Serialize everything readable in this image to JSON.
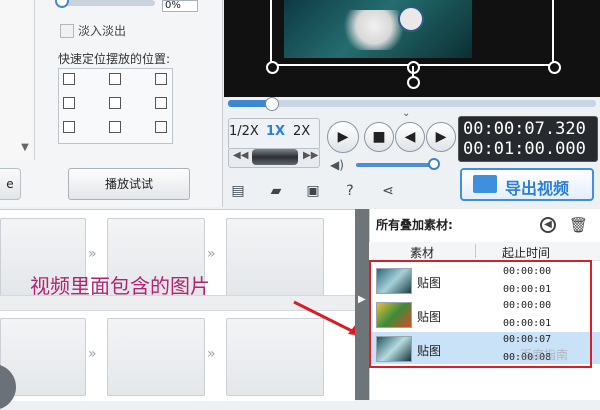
{
  "left_panel": {
    "percent_value": "0%",
    "fade_label": "淡入淡出",
    "quick_position_label": "快速定位摆放的位置:",
    "play_test_button": "播放试试"
  },
  "player": {
    "speed_options": [
      "1/2X",
      "1X",
      "2X"
    ],
    "selected_speed": "1X",
    "current_time": "00:00:07.320",
    "total_time": "00:01:00.000",
    "seek_progress": 0.12,
    "volume_level": 0.9
  },
  "toolbar": {
    "icons": [
      "new-icon",
      "open-folder-icon",
      "save-icon",
      "help-icon",
      "share-icon"
    ],
    "export_label": "导出视频"
  },
  "storyboard": {
    "annotation": "视频里面包含的图片"
  },
  "overlay_panel": {
    "title": "所有叠加素材:",
    "col_material": "素材",
    "col_time": "起止时间",
    "rows": [
      {
        "name": "贴图",
        "start": "00:00:00",
        "end": "00:00:01",
        "selected": false
      },
      {
        "name": "贴图",
        "start": "00:00:00",
        "end": "00:00:01",
        "selected": false
      },
      {
        "name": "贴图",
        "start": "00:00:07",
        "end": "00:00:08",
        "selected": true
      }
    ],
    "watermark": "百度指南"
  },
  "colors": {
    "accent": "#3f8fde",
    "annotation": "#b2246f",
    "highlight_box": "#d61f26"
  }
}
